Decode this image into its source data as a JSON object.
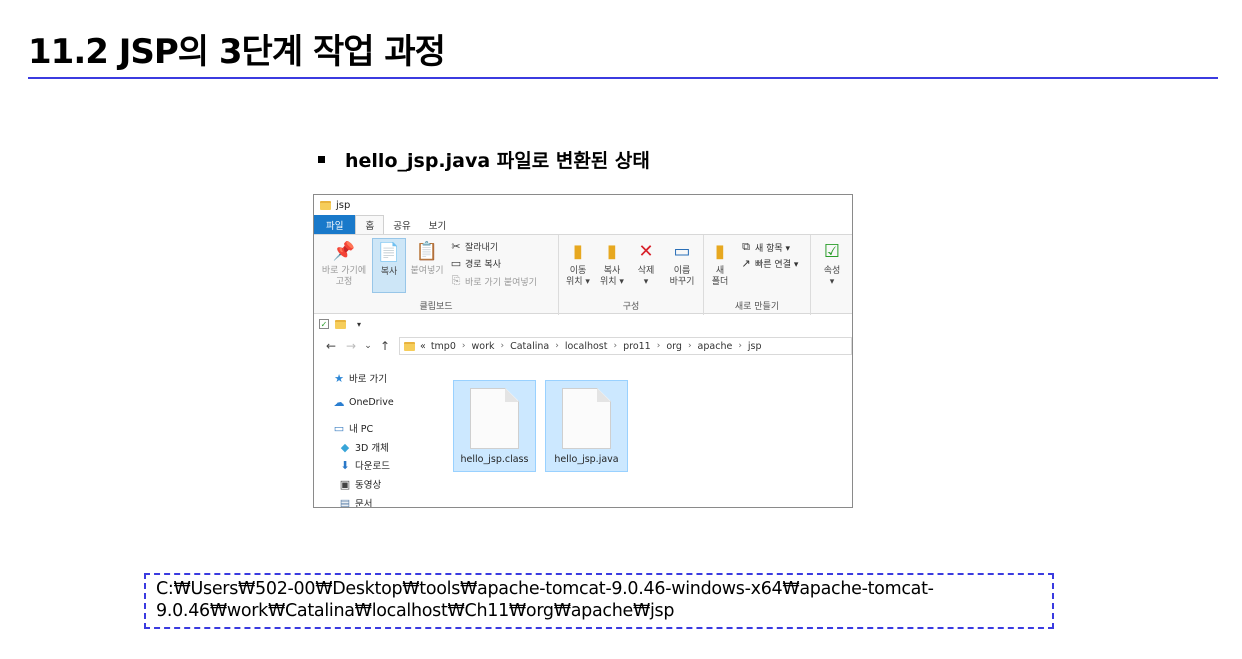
{
  "slide": {
    "title": "11.2 JSP의 3단계 작업 과정",
    "bullet": "hello_jsp.java 파일로 변환된 상태",
    "path_line1": "C:₩Users₩502-00₩Desktop₩tools₩apache-tomcat-9.0.46-windows-x64₩apache-tomcat-",
    "path_line2": "9.0.46₩work₩Catalina₩localhost₩Ch11₩org₩apache₩jsp"
  },
  "explorer": {
    "window_title": "jsp",
    "tabs": [
      "파일",
      "홈",
      "공유",
      "보기"
    ],
    "ribbon": {
      "clipboard": {
        "label": "클립보드",
        "pin_label_1": "바로 가기에",
        "pin_label_2": "고정",
        "copy": "복사",
        "paste": "붙여넣기",
        "cut": "잘라내기",
        "copy_path": "경로 복사",
        "paste_shortcut": "바로 가기 붙여넣기"
      },
      "organize": {
        "label": "구성",
        "move_1": "이동",
        "move_2": "위치 ▾",
        "copyto_1": "복사",
        "copyto_2": "위치 ▾",
        "delete_1": "삭제",
        "delete_2": "▾",
        "rename_1": "이름",
        "rename_2": "바꾸기"
      },
      "new": {
        "label": "새로 만들기",
        "folder_1": "새",
        "folder_2": "폴더",
        "new_item": "새 항목 ▾",
        "easy_access": "빠른 연결 ▾"
      },
      "open": {
        "properties_1": "속성",
        "properties_2": "▾"
      }
    },
    "address": {
      "prefix": "«",
      "crumbs": [
        "tmp0",
        "work",
        "Catalina",
        "localhost",
        "pro11",
        "org",
        "apache",
        "jsp"
      ]
    },
    "nav": {
      "quick_access": "바로 가기",
      "onedrive": "OneDrive",
      "this_pc": "내 PC",
      "objects_3d": "3D 개체",
      "downloads": "다운로드",
      "videos": "동영상",
      "documents": "문서"
    },
    "files": [
      {
        "name": "hello_jsp.class"
      },
      {
        "name": "hello_jsp.java"
      }
    ]
  }
}
